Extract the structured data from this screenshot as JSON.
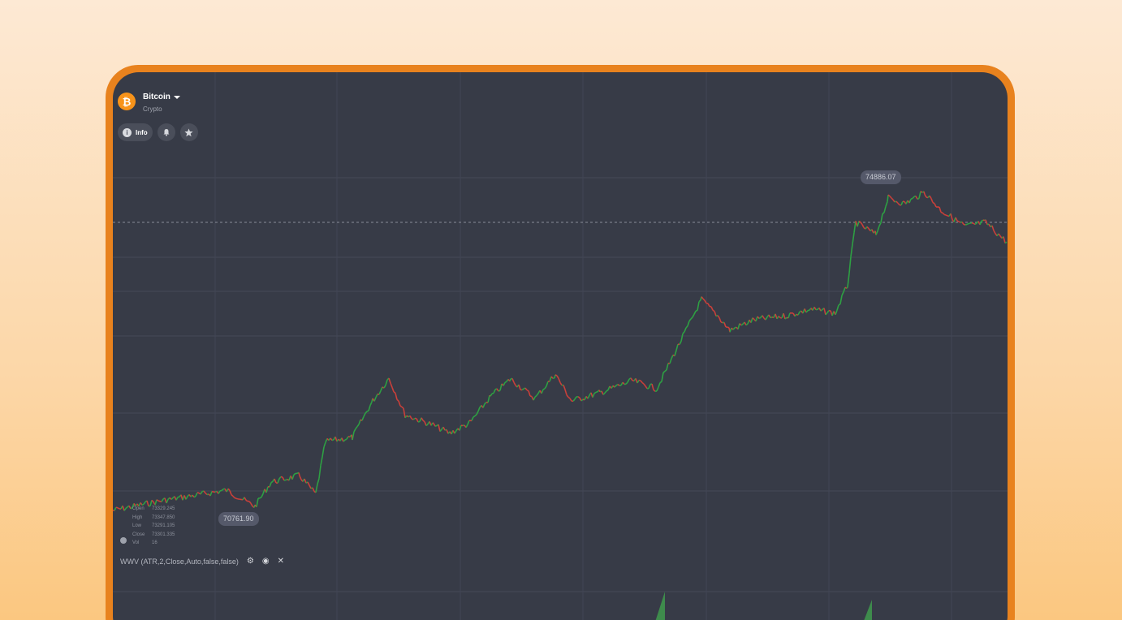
{
  "asset": {
    "name": "Bitcoin",
    "category": "Crypto",
    "icon": "bitcoin-icon",
    "icon_glyph": "₿"
  },
  "actions": {
    "info_label": "Info",
    "info_icon": "info-icon",
    "alert_icon": "bell-icon",
    "favorite_icon": "star-icon"
  },
  "chart": {
    "high_label": "74886.07",
    "low_label": "70761.90",
    "ohlc": [
      {
        "key": "Open",
        "value": "73329.245"
      },
      {
        "key": "High",
        "value": "73347.850"
      },
      {
        "key": "Low",
        "value": "73291.105"
      },
      {
        "key": "Close",
        "value": "73301.335"
      },
      {
        "key": "Vol",
        "value": "16"
      }
    ],
    "indicator": "WWV (ATR,2,Close,Auto,false,false)",
    "colors": {
      "up": "#2ea043",
      "down": "#c9403a",
      "background": "#373b47",
      "frame": "#e8821e"
    }
  }
}
